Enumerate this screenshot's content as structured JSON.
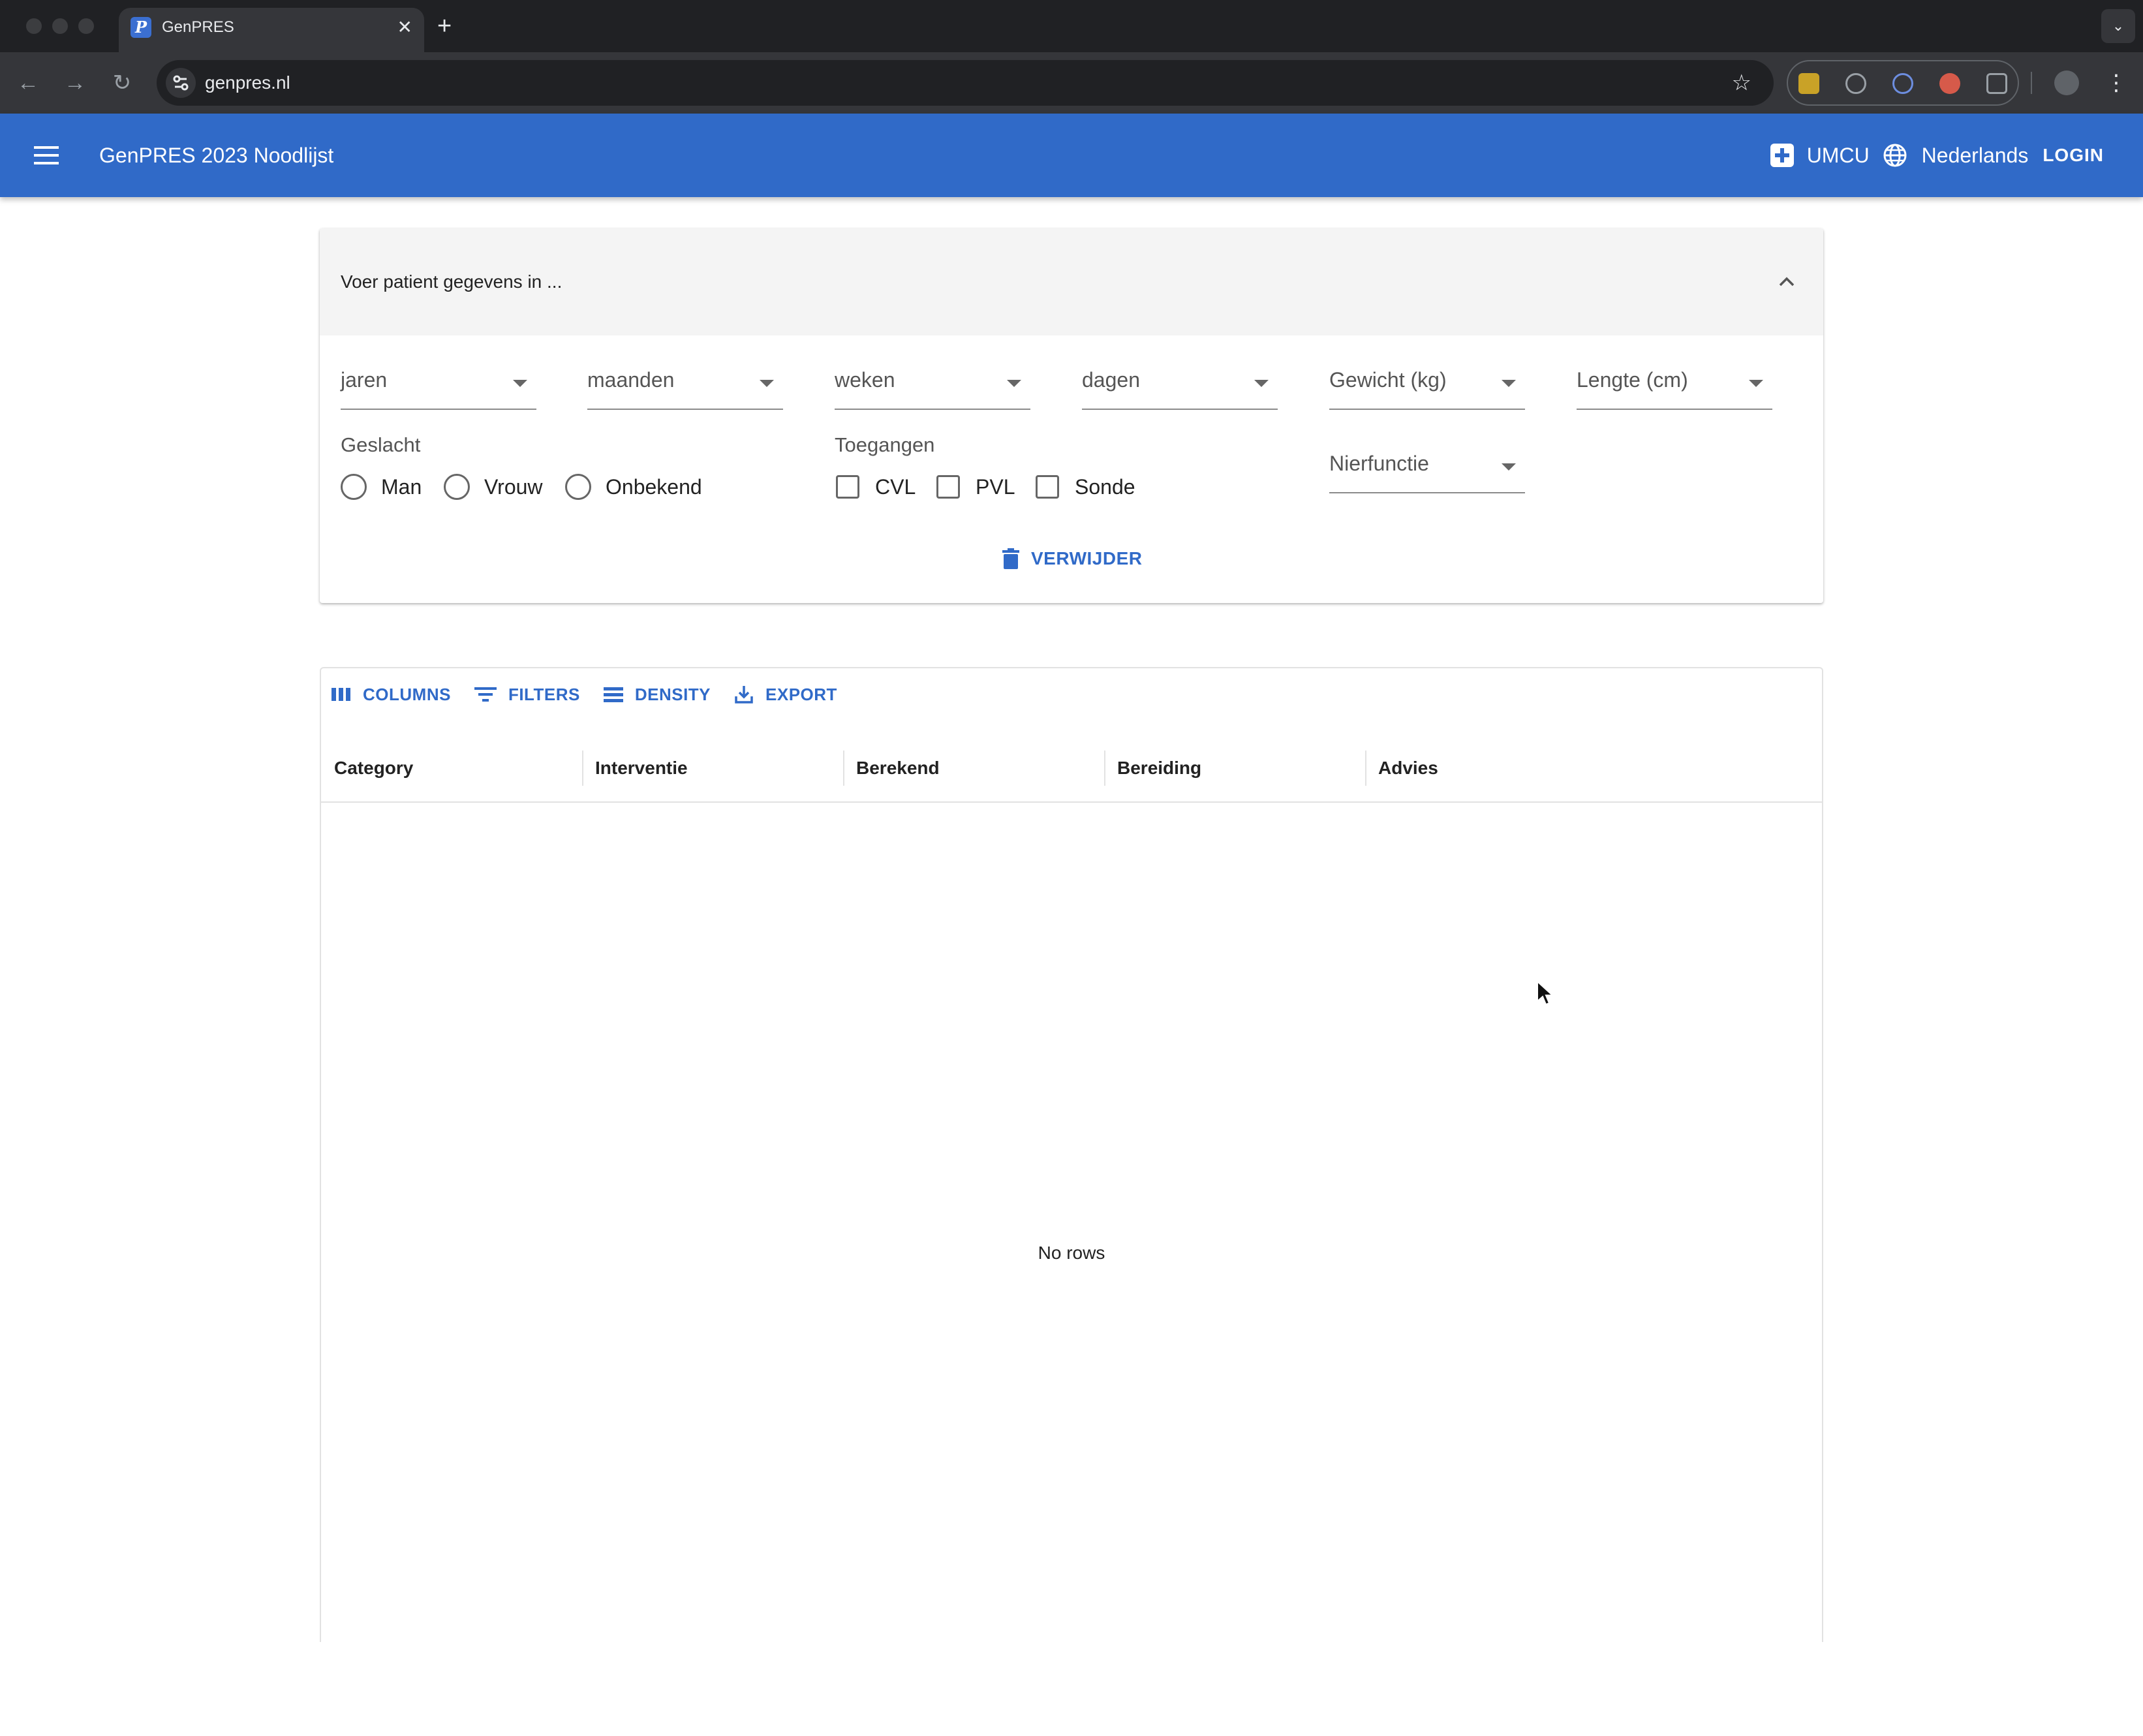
{
  "browser": {
    "tab_title": "GenPRES",
    "favicon_letter": "P",
    "url": "genpres.nl",
    "close_glyph": "✕",
    "newtab_glyph": "+"
  },
  "appbar": {
    "title": "GenPRES 2023 Noodlijst",
    "hospital": "UMCU",
    "language": "Nederlands",
    "login": "LOGIN"
  },
  "patient": {
    "header": "Voer patient gegevens in ...",
    "selects": {
      "jaren": "jaren",
      "maanden": "maanden",
      "weken": "weken",
      "dagen": "dagen",
      "gewicht": "Gewicht (kg)",
      "lengte": "Lengte (cm)",
      "nierfunctie": "Nierfunctie"
    },
    "gender": {
      "label": "Geslacht",
      "options": [
        "Man",
        "Vrouw",
        "Onbekend"
      ]
    },
    "access": {
      "label": "Toegangen",
      "options": [
        "CVL",
        "PVL",
        "Sonde"
      ]
    },
    "delete_label": "VERWIJDER"
  },
  "grid": {
    "toolbar": {
      "columns": "COLUMNS",
      "filters": "FILTERS",
      "density": "DENSITY",
      "export": "EXPORT"
    },
    "columns": [
      "Category",
      "Interventie",
      "Berekend",
      "Bereiding",
      "Advies"
    ],
    "empty_text": "No rows"
  },
  "colors": {
    "appbar": "#306ac8",
    "accent": "#306ac8",
    "chrome_dark": "#202124",
    "chrome_toolbar": "#35363a"
  }
}
